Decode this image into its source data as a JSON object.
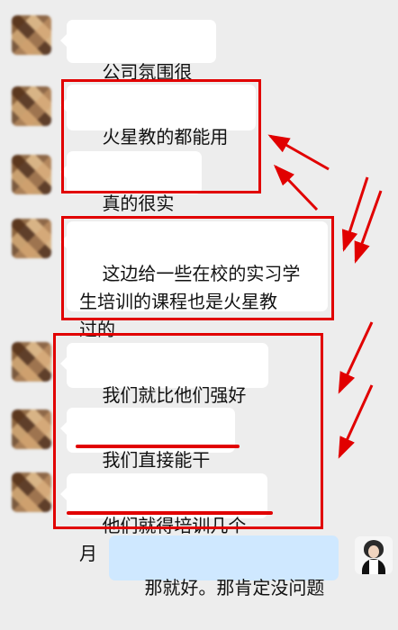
{
  "messages": [
    {
      "id": "m1",
      "text": "公司氛围很好"
    },
    {
      "id": "m2",
      "text": "火星教的都能用上"
    },
    {
      "id": "m3",
      "text": "真的很实用"
    },
    {
      "id": "m4",
      "text": "这边给一些在校的实习学\n生培训的课程也是火星教\n过的"
    },
    {
      "id": "m5",
      "text": "我们就比他们强好多"
    },
    {
      "id": "m6",
      "text": "我们直接能干活"
    },
    {
      "id": "m7",
      "text": "他们就得培训几个月"
    },
    {
      "id": "m8",
      "text": "那就好。那肯定没问题"
    }
  ],
  "colors": {
    "background": "#ededed",
    "bubble_incoming": "#ffffff",
    "bubble_outgoing": "#cfe8ff",
    "annotation_red": "#e10000"
  },
  "icons": {
    "contact_avatar": "blurred-avatar",
    "self_avatar": "woman-portrait-avatar"
  }
}
